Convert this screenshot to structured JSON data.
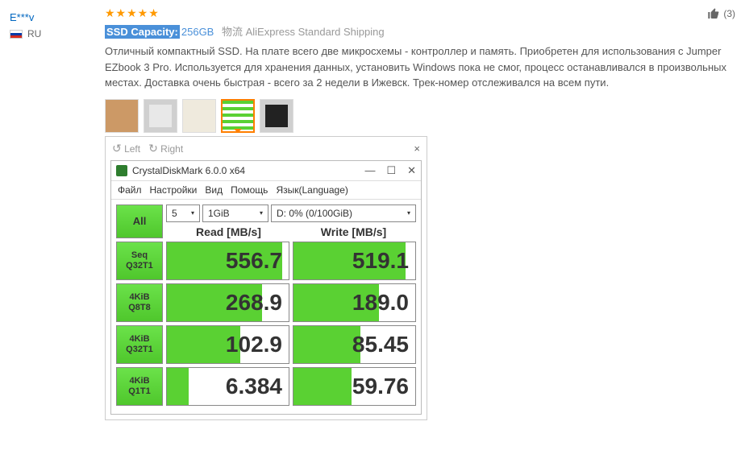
{
  "user": {
    "name": "E***v",
    "country_code": "RU"
  },
  "stars_display": "★★★★★",
  "helpful_count": "(3)",
  "capacity": {
    "label": "SSD Capacity:",
    "value": "256GB"
  },
  "logistics": "物流 AliExpress Standard Shipping",
  "review_text": "Отличный компактный SSD. На плате всего две микросхемы - контроллер и память. Приобретен для использования с Jumper EZbook 3 Pro. Используется для хранения данных, установить Windows пока не смог, процесс останавливался в произвольных местах. Доставка очень быстрая - всего за 2 недели в Ижевск. Трек-номер отслеживался на всем пути.",
  "lightbox_nav": {
    "left": "Left",
    "right": "Right",
    "close": "×"
  },
  "cdm": {
    "title": "CrystalDiskMark 6.0.0 x64",
    "minimize": "—",
    "maximize": "☐",
    "close": "✕",
    "menu": [
      "Файл",
      "Настройки",
      "Вид",
      "Помощь",
      "Язык(Language)"
    ],
    "all_label": "All",
    "sel_count": "5",
    "sel_size": "1GiB",
    "sel_drive": "D: 0% (0/100GiB)",
    "read_header": "Read [MB/s]",
    "write_header": "Write [MB/s]",
    "rows": [
      {
        "l1": "Seq",
        "l2": "Q32T1",
        "read": "556.7",
        "rpct": 95,
        "write": "519.1",
        "wpct": 92
      },
      {
        "l1": "4KiB",
        "l2": "Q8T8",
        "read": "268.9",
        "rpct": 78,
        "write": "189.0",
        "wpct": 70
      },
      {
        "l1": "4KiB",
        "l2": "Q32T1",
        "read": "102.9",
        "rpct": 60,
        "write": "85.45",
        "wpct": 55
      },
      {
        "l1": "4KiB",
        "l2": "Q1T1",
        "read": "6.384",
        "rpct": 18,
        "write": "59.76",
        "wpct": 48
      }
    ]
  },
  "chart_data": {
    "type": "table",
    "title": "CrystalDiskMark 6.0.0 x64",
    "selectors": {
      "iterations": 5,
      "test_size": "1GiB",
      "drive": "D: 0% (0/100GiB)"
    },
    "columns": [
      "Test",
      "Read [MB/s]",
      "Write [MB/s]"
    ],
    "rows": [
      [
        "Seq Q32T1",
        556.7,
        519.1
      ],
      [
        "4KiB Q8T8",
        268.9,
        189.0
      ],
      [
        "4KiB Q32T1",
        102.9,
        85.45
      ],
      [
        "4KiB Q1T1",
        6.384,
        59.76
      ]
    ]
  }
}
